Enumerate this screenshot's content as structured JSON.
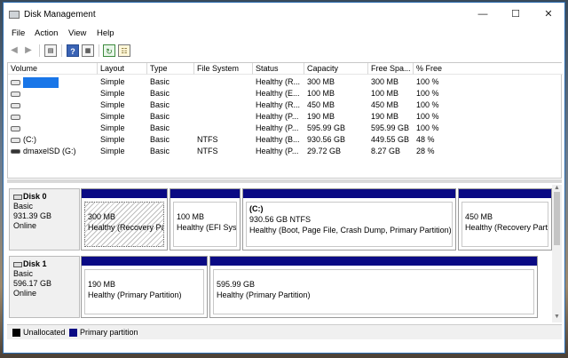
{
  "window": {
    "title": "Disk Management",
    "controls": {
      "minimize": "—",
      "maximize": "☐",
      "close": "✕"
    }
  },
  "menu": [
    "File",
    "Action",
    "View",
    "Help"
  ],
  "toolbar": {
    "icons": [
      "back-arrow-icon",
      "forward-arrow-icon",
      "console-tree-icon",
      "help-icon",
      "details-pane-icon",
      "refresh-icon",
      "properties-icon"
    ]
  },
  "volume_table": {
    "columns": [
      "Volume",
      "Layout",
      "Type",
      "File System",
      "Status",
      "Capacity",
      "Free Spa...",
      "% Free"
    ],
    "rows": [
      {
        "volume": "",
        "layout": "Simple",
        "type": "Basic",
        "fs": "",
        "status": "Healthy (R...",
        "capacity": "300 MB",
        "free": "300 MB",
        "pct": "100 %"
      },
      {
        "volume": "",
        "layout": "Simple",
        "type": "Basic",
        "fs": "",
        "status": "Healthy (E...",
        "capacity": "100 MB",
        "free": "100 MB",
        "pct": "100 %"
      },
      {
        "volume": "",
        "layout": "Simple",
        "type": "Basic",
        "fs": "",
        "status": "Healthy (R...",
        "capacity": "450 MB",
        "free": "450 MB",
        "pct": "100 %"
      },
      {
        "volume": "",
        "layout": "Simple",
        "type": "Basic",
        "fs": "",
        "status": "Healthy (P...",
        "capacity": "190 MB",
        "free": "190 MB",
        "pct": "100 %"
      },
      {
        "volume": "",
        "layout": "Simple",
        "type": "Basic",
        "fs": "",
        "status": "Healthy (P...",
        "capacity": "595.99 GB",
        "free": "595.99 GB",
        "pct": "100 %"
      },
      {
        "volume": "(C:)",
        "layout": "Simple",
        "type": "Basic",
        "fs": "NTFS",
        "status": "Healthy (B...",
        "capacity": "930.56 GB",
        "free": "449.55 GB",
        "pct": "48 %"
      },
      {
        "volume": "dmaxelSD (G:)",
        "layout": "Simple",
        "type": "Basic",
        "fs": "NTFS",
        "status": "Healthy (P...",
        "capacity": "29.72 GB",
        "free": "8.27 GB",
        "pct": "28 %"
      }
    ]
  },
  "disks": [
    {
      "name": "Disk 0",
      "type": "Basic",
      "size": "931.39 GB",
      "status": "Online",
      "partitions": [
        {
          "label": "",
          "size": "300 MB",
          "status": "Healthy (Recovery Parti"
        },
        {
          "label": "",
          "size": "100 MB",
          "status": "Healthy (EFI Syste"
        },
        {
          "label": "(C:)",
          "size": "930.56 GB NTFS",
          "status": "Healthy (Boot, Page File, Crash Dump, Primary Partition)"
        },
        {
          "label": "",
          "size": "450 MB",
          "status": "Healthy (Recovery Parti"
        }
      ]
    },
    {
      "name": "Disk 1",
      "type": "Basic",
      "size": "596.17 GB",
      "status": "Online",
      "partitions": [
        {
          "label": "",
          "size": "190 MB",
          "status": "Healthy (Primary Partition)"
        },
        {
          "label": "",
          "size": "595.99 GB",
          "status": "Healthy (Primary Partition)"
        }
      ]
    }
  ],
  "legend": [
    {
      "label": "Unallocated",
      "color": "#000000"
    },
    {
      "label": "Primary partition",
      "color": "#0a0a84"
    }
  ]
}
